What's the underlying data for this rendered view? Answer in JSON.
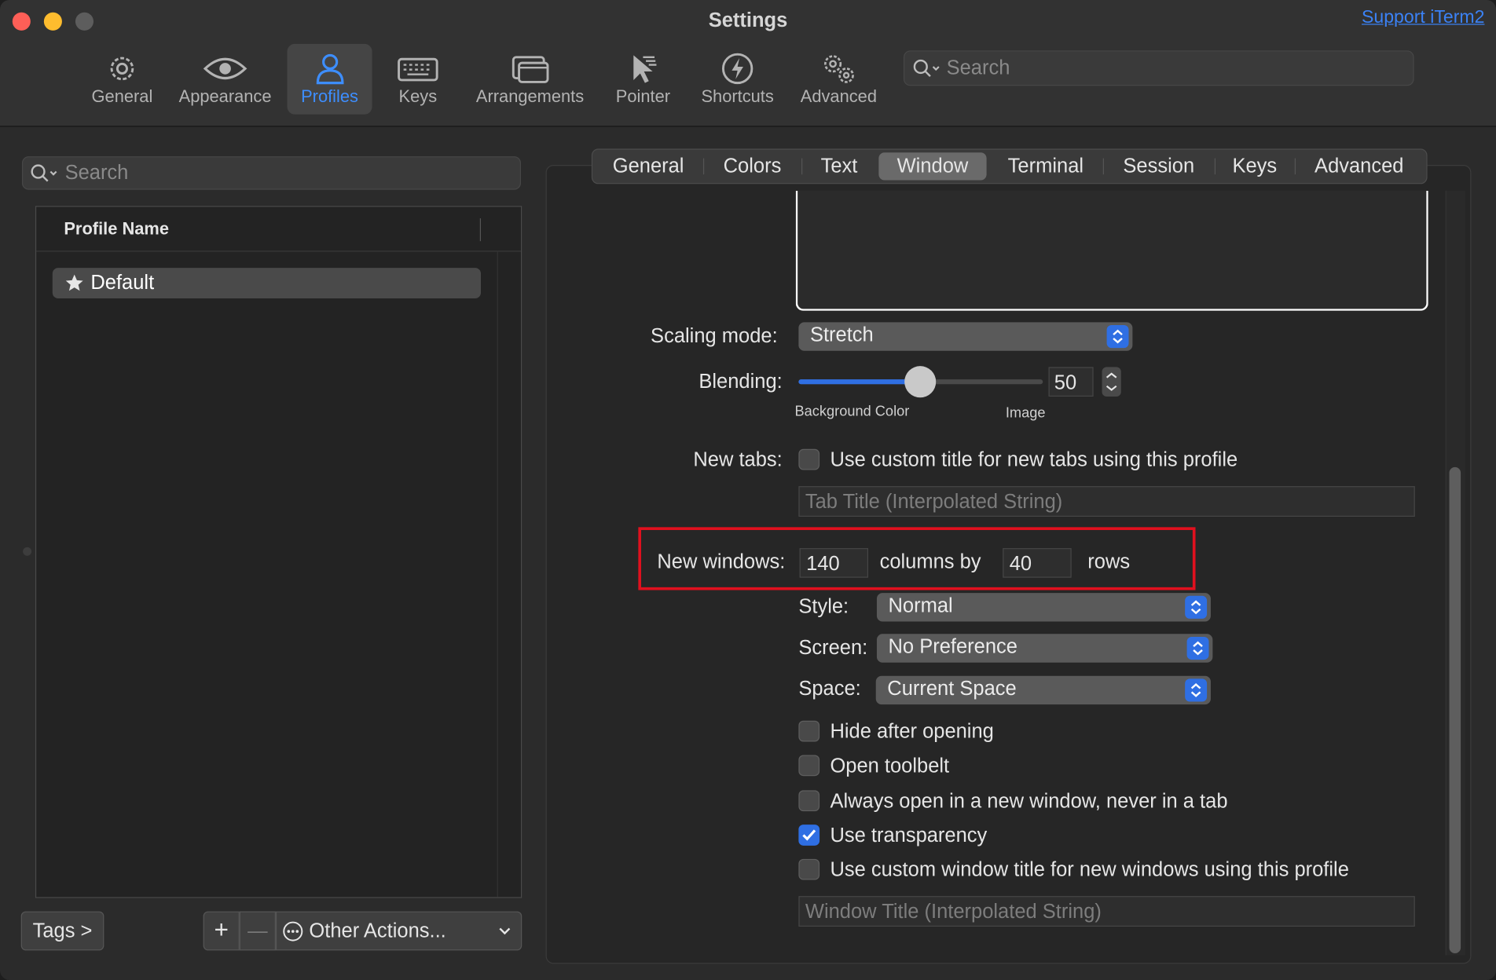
{
  "window": {
    "title": "Settings",
    "support_link": "Support iTerm2",
    "toolbar": [
      {
        "label": "General",
        "icon": "gear-icon"
      },
      {
        "label": "Appearance",
        "icon": "eye-icon"
      },
      {
        "label": "Profiles",
        "icon": "person-icon",
        "active": true
      },
      {
        "label": "Keys",
        "icon": "keyboard-icon"
      },
      {
        "label": "Arrangements",
        "icon": "windows-icon"
      },
      {
        "label": "Pointer",
        "icon": "pointer-icon"
      },
      {
        "label": "Shortcuts",
        "icon": "bolt-icon"
      },
      {
        "label": "Advanced",
        "icon": "gears-icon"
      }
    ],
    "search_placeholder": "Search"
  },
  "profiles": {
    "search_placeholder": "Search",
    "column_header": "Profile Name",
    "items": [
      {
        "name": "Default",
        "default": true
      }
    ],
    "tags_button": "Tags >",
    "add_button": "+",
    "remove_button": "—",
    "other_actions": "Other Actions..."
  },
  "tabs": [
    "General",
    "Colors",
    "Text",
    "Window",
    "Terminal",
    "Session",
    "Keys",
    "Advanced"
  ],
  "active_tab": "Window",
  "window_settings": {
    "scaling_label": "Scaling mode:",
    "scaling_value": "Stretch",
    "blending_label": "Blending:",
    "blending_value": "50",
    "blending_left": "Background Color",
    "blending_right": "Image",
    "new_tabs_label": "New tabs:",
    "new_tabs_checkbox": "Use custom title for new tabs using this profile",
    "tab_title_placeholder": "Tab Title (Interpolated String)",
    "new_windows_label": "New windows:",
    "columns": "140",
    "columns_by": "columns by",
    "rows_value": "40",
    "rows_label": "rows",
    "style_label": "Style:",
    "style_value": "Normal",
    "screen_label": "Screen:",
    "screen_value": "No Preference",
    "space_label": "Space:",
    "space_value": "Current Space",
    "hide_after_opening": "Hide after opening",
    "open_toolbelt": "Open toolbelt",
    "always_new_window": "Always open in a new window, never in a tab",
    "use_transparency": "Use transparency",
    "custom_window_title": "Use custom window title for new windows using this profile",
    "window_title_placeholder": "Window Title (Interpolated String)"
  },
  "colors": {
    "accent": "#2f6fe3",
    "highlight_box": "#e0101e",
    "link": "#3b82f6"
  }
}
